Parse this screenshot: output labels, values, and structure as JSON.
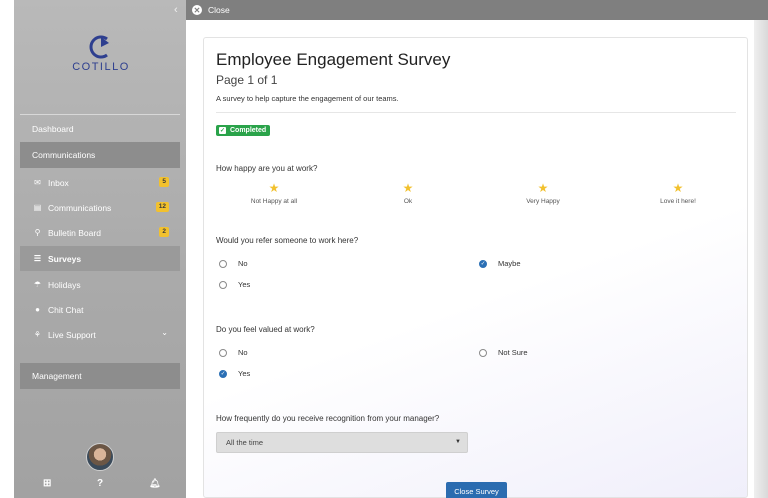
{
  "sidebar": {
    "collapse_icon": "chevron-left-icon",
    "logo_text": "COTILLO",
    "brand_color": "#2e3f8f",
    "items": [
      {
        "label": "Dashboard"
      },
      {
        "label": "Communications"
      },
      {
        "label": "Inbox",
        "icon": "envelope-icon",
        "badge": "5"
      },
      {
        "label": "Communications",
        "icon": "card-icon",
        "badge": "12"
      },
      {
        "label": "Bulletin Board",
        "icon": "pin-icon",
        "badge": "2"
      },
      {
        "label": "Surveys",
        "icon": "list-icon"
      },
      {
        "label": "Holidays",
        "icon": "umbrella-icon"
      },
      {
        "label": "Chit Chat",
        "icon": "chat-icon"
      },
      {
        "label": "Live Support",
        "icon": "sitemap-icon"
      },
      {
        "label": "Management"
      }
    ],
    "footer": {
      "grid_icon": "⊞",
      "help_icon": "?",
      "bell_icon": "bell-icon"
    }
  },
  "topbar": {
    "close_label": "Close"
  },
  "survey": {
    "title": "Employee Engagement Survey",
    "page": "Page 1 of 1",
    "description": "A survey to help capture the engagement of our teams.",
    "status": "Completed",
    "q1": {
      "label": "How happy are you at work?",
      "options": [
        "Not Happy at all",
        "Ok",
        "Very Happy",
        "Love it here!"
      ]
    },
    "q2": {
      "label": "Would you refer someone to work here?",
      "options": [
        "No",
        "Maybe",
        "Yes"
      ],
      "selected": "Maybe"
    },
    "q3": {
      "label": "Do you feel valued at work?",
      "options": [
        "No",
        "Not Sure",
        "Yes"
      ],
      "selected": "Yes"
    },
    "q4": {
      "label": "How frequently do you receive recognition from your manager?",
      "selected_value": "All the time"
    },
    "close_button": "Close Survey",
    "accent_color": "#2b6cb0",
    "status_color": "#2aa34a",
    "star_color": "#f2c12e"
  }
}
